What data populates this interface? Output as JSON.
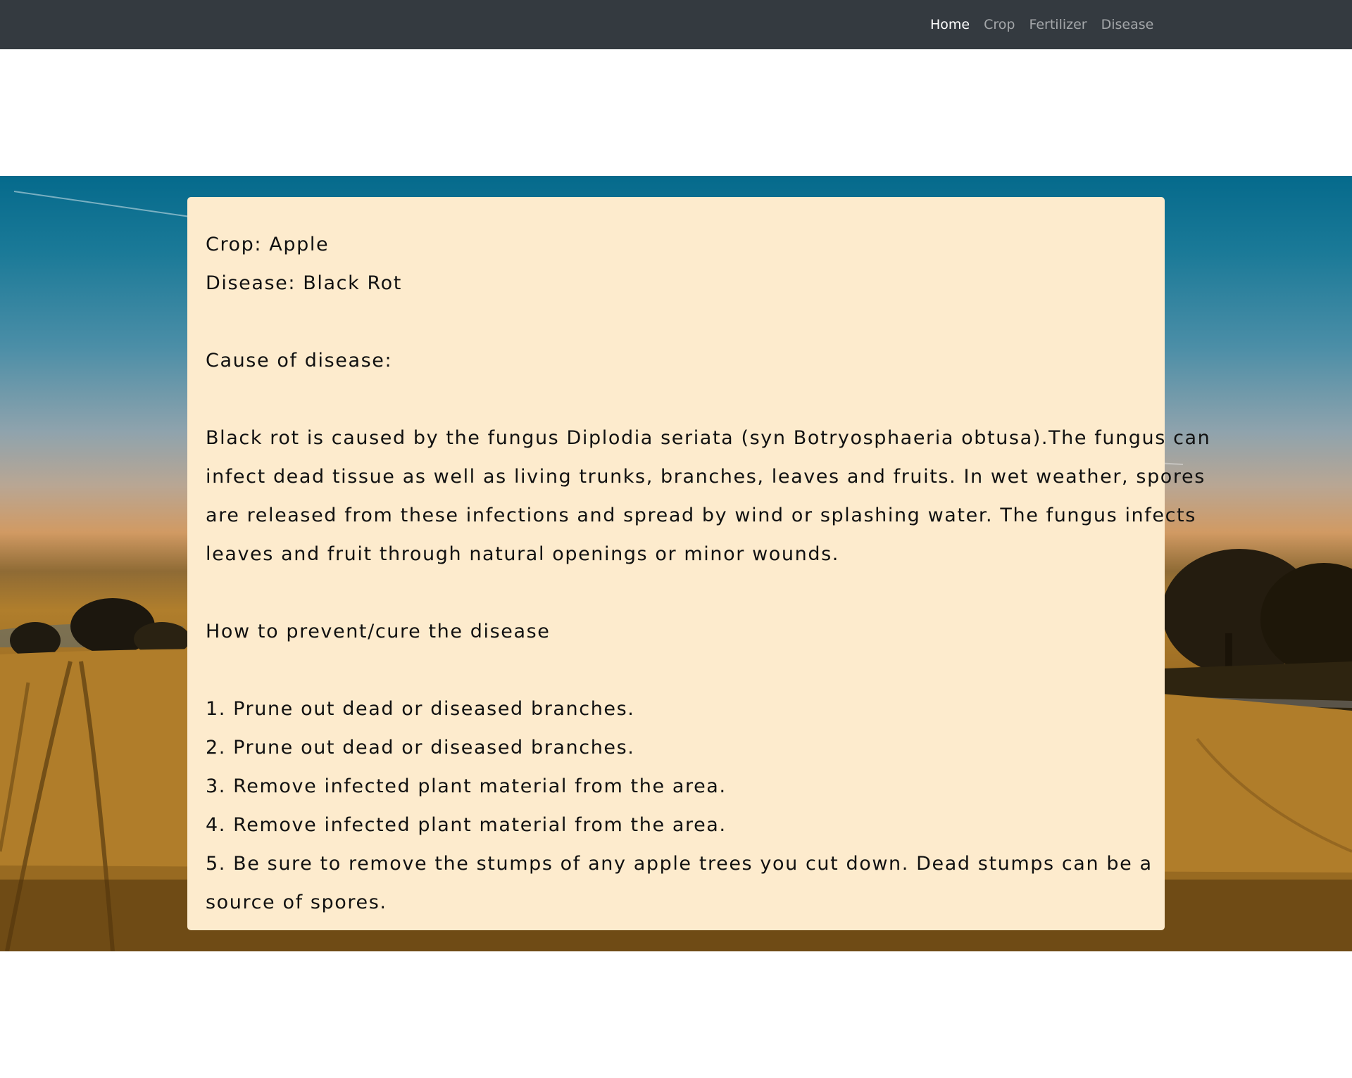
{
  "nav": {
    "items": [
      {
        "label": "Home",
        "active": true
      },
      {
        "label": "Crop",
        "active": false
      },
      {
        "label": "Fertilizer",
        "active": false
      },
      {
        "label": "Disease",
        "active": false
      }
    ]
  },
  "result": {
    "crop_line": "Crop: Apple",
    "disease_line": "Disease: Black Rot",
    "cause_heading": "Cause of disease:",
    "cause_lines": [
      "Black rot is caused by the fungus Diplodia seriata (syn Botryosphaeria obtusa).The fungus can",
      "infect dead tissue as well as living trunks, branches, leaves and fruits. In wet weather, spores",
      "are released from these infections and spread by wind or splashing water. The fungus infects",
      "leaves and fruit through natural openings or minor wounds."
    ],
    "prevent_heading": "How to prevent/cure the disease",
    "steps": [
      "1. Prune out dead or diseased branches.",
      "2. Prune out dead or diseased branches.",
      "3. Remove infected plant material from the area.",
      "4. Remove infected plant material from the area.",
      "5. Be sure to remove the stumps of any apple trees you cut down. Dead stumps can be a"
    ],
    "steps_tail": "source of spores."
  },
  "colors": {
    "navbar": "#343a40",
    "card": "#fdebcd",
    "sky": "#056a8c",
    "field": "#b07e2c"
  }
}
